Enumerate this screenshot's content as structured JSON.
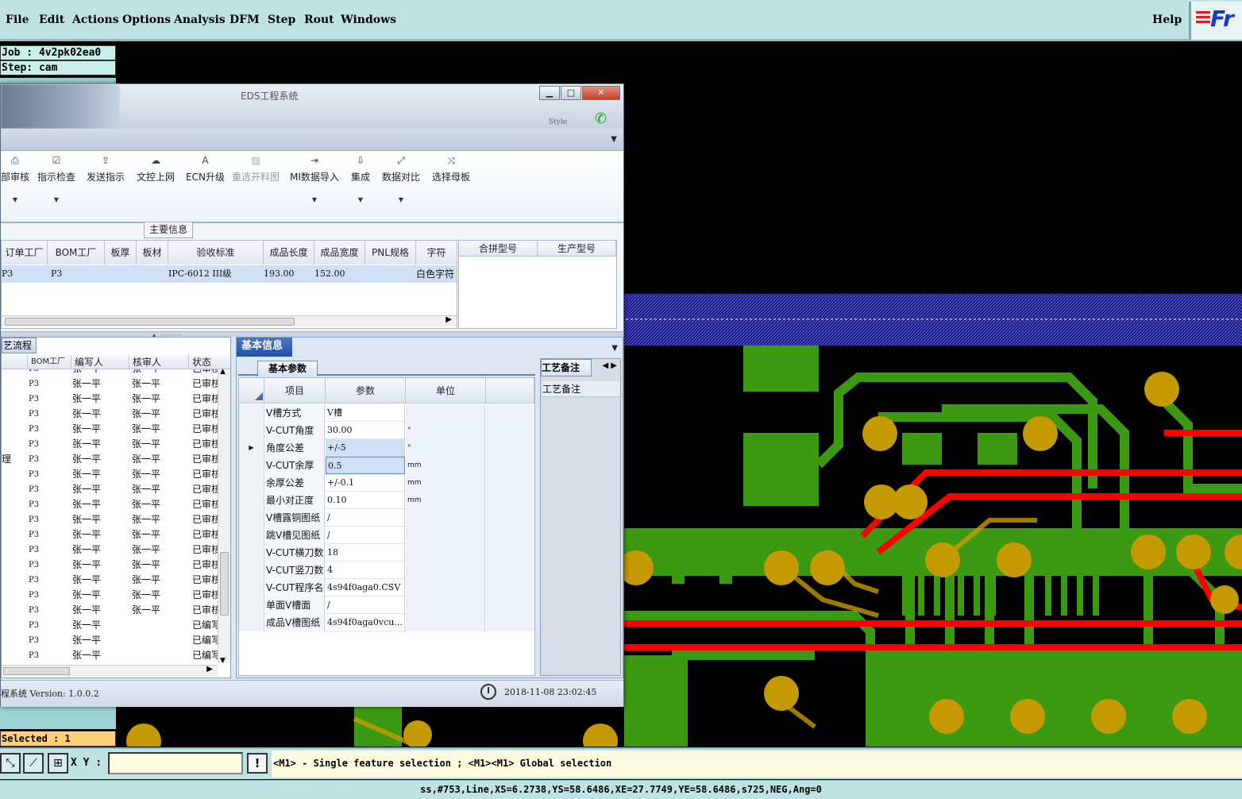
{
  "menubar": {
    "items": [
      "File",
      "Edit",
      "Actions",
      "Options",
      "Analysis",
      "DFM",
      "Step",
      "Rout",
      "Windows"
    ],
    "help": "Help",
    "logo_text": "Fr"
  },
  "info": {
    "job": "Job : 4v2pk02ea0",
    "step": "Step: cam",
    "selected": "Selected : 1"
  },
  "eds": {
    "title": "EDS工程系统",
    "style_label": "Style",
    "ribbon": [
      {
        "label": "部审核",
        "icon": "printer-icon",
        "dropdown": true
      },
      {
        "label": "指示检查",
        "icon": "check-icon",
        "dropdown": true
      },
      {
        "label": "发送指示",
        "icon": "upload-icon",
        "dropdown": false
      },
      {
        "label": "文控上网",
        "icon": "cloud-upload-icon",
        "dropdown": false
      },
      {
        "label": "ECN升级",
        "icon": "ecn-icon",
        "dropdown": false
      },
      {
        "label": "重选开料图",
        "icon": "image-icon",
        "dropdown": false
      },
      {
        "label": "MI数据导入",
        "icon": "import-icon",
        "dropdown": true
      },
      {
        "label": "集成",
        "icon": "download-icon",
        "dropdown": true
      },
      {
        "label": "数据对比",
        "icon": "compare-icon",
        "dropdown": true
      },
      {
        "label": "选择母板",
        "icon": "shuffle-icon",
        "dropdown": false
      }
    ],
    "main_group_label": "主要信息",
    "main_table": {
      "headers": [
        "订单工厂",
        "BOM工厂",
        "板厚",
        "板材",
        "验收标准",
        "成品长度",
        "成品宽度",
        "PNL规格",
        "字符"
      ],
      "row": [
        "P3",
        "P3",
        "",
        "",
        "IPC-6012 III级",
        "193.00",
        "152.00",
        "",
        "白色字符"
      ]
    },
    "side_table": {
      "headers": [
        "合拼型号",
        "生产型号"
      ]
    },
    "process": {
      "tab": "艺流程",
      "headers": [
        "BOM工厂",
        "编写人",
        "核审人",
        "状态"
      ],
      "side_label": "理",
      "rows": [
        [
          "P3",
          "张一平",
          "张一平",
          "已审核"
        ],
        [
          "P3",
          "张一平",
          "张一平",
          "已审核"
        ],
        [
          "P3",
          "张一平",
          "张一平",
          "已审核"
        ],
        [
          "P3",
          "张一平",
          "张一平",
          "已审核"
        ],
        [
          "P3",
          "张一平",
          "张一平",
          "已审核"
        ],
        [
          "P3",
          "张一平",
          "张一平",
          "已审核"
        ],
        [
          "P3",
          "张一平",
          "张一平",
          "已审核"
        ],
        [
          "P3",
          "张一平",
          "张一平",
          "已审核"
        ],
        [
          "P3",
          "张一平",
          "张一平",
          "已审核"
        ],
        [
          "P3",
          "张一平",
          "张一平",
          "已审核"
        ],
        [
          "P3",
          "张一平",
          "张一平",
          "已审核"
        ],
        [
          "P3",
          "张一平",
          "张一平",
          "已审核"
        ],
        [
          "P3",
          "张一平",
          "张一平",
          "已审核"
        ],
        [
          "P3",
          "张一平",
          "张一平",
          "已审核"
        ],
        [
          "P3",
          "张一平",
          "张一平",
          "已审核"
        ],
        [
          "P3",
          "张一平",
          "张一平",
          "已审核"
        ],
        [
          "P3",
          "张一平",
          "张一平",
          "已审核"
        ],
        [
          "P3",
          "张一平",
          "",
          "已编写"
        ],
        [
          "P3",
          "张一平",
          "",
          "已编写"
        ],
        [
          "P3",
          "张一平",
          "",
          "已编写"
        ]
      ]
    },
    "basic": {
      "tab": "基本信息",
      "param_tab": "基本参数",
      "headers": [
        "项目",
        "参数",
        "单位"
      ],
      "rows": [
        [
          "V槽方式",
          "V槽",
          ""
        ],
        [
          "V-CUT角度",
          "30.00",
          "°"
        ],
        [
          "角度公差",
          "+/-5",
          "°"
        ],
        [
          "V-CUT余厚",
          "0.5",
          "mm"
        ],
        [
          "余厚公差",
          "+/-0.1",
          "mm"
        ],
        [
          "最小对正度",
          "0.10",
          "mm"
        ],
        [
          "V槽露铜图纸",
          "/",
          ""
        ],
        [
          "跳V槽见图纸",
          "/",
          ""
        ],
        [
          "V-CUT横刀数",
          "18",
          ""
        ],
        [
          "V-CUT竖刀数",
          "4",
          ""
        ],
        [
          "V-CUT程序名",
          "4s94f0aga0.CSV",
          ""
        ],
        [
          "单面V槽面",
          "/",
          ""
        ],
        [
          "成品V槽图纸",
          "4s94f0aga0vcu...",
          ""
        ]
      ],
      "remark_tab": "工艺备注",
      "remark_label": "工艺备注"
    },
    "status": {
      "version": "程系统 Version: 1.0.0.2",
      "datetime": "2018-11-08 23:02:45"
    }
  },
  "cmd": {
    "xy_label": "X Y :",
    "xy_value": "",
    "message": "<M1> - Single feature selection ; <M1><M1> Global selection"
  },
  "statusline": "ss,#753,Line,XS=6.2738,YS=58.6486,XE=27.7749,YE=58.6486,s725,NEG,Ang=0",
  "colors": {
    "pcb_green": "#3c9a12",
    "pcb_red": "#ff0000",
    "pcb_pad": "#c59a00",
    "pcb_blue": "#2a2aa8",
    "panel_bg": "#bfe3e3"
  }
}
